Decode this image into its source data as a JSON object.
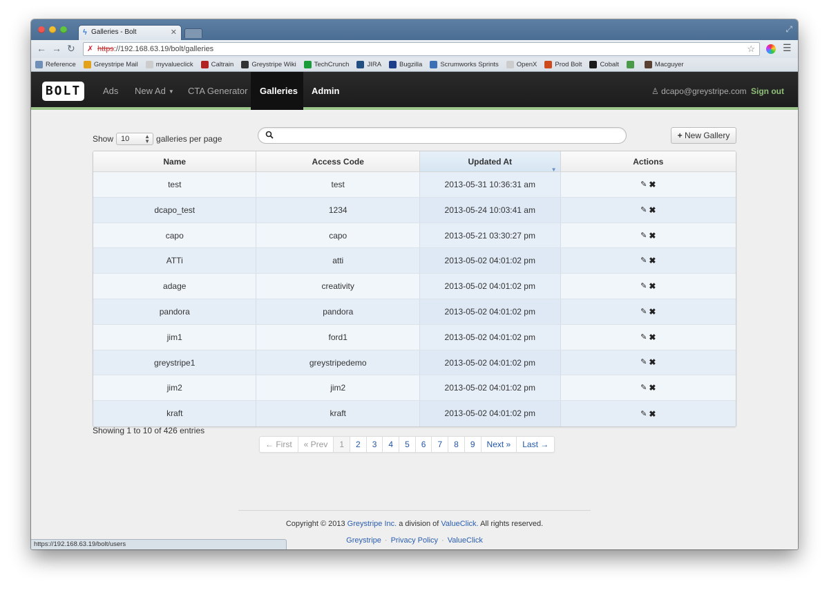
{
  "browser": {
    "tab_title": "Galleries - Bolt",
    "url_protocol": "https",
    "url_rest": "://192.168.63.19/bolt/galleries",
    "status_url": "https://192.168.63.19/bolt/users"
  },
  "bookmarks": [
    {
      "label": "Reference",
      "icon": "folder-icon",
      "color": "#6f8fb6"
    },
    {
      "label": "Greystripe Mail",
      "icon": "mail-icon",
      "color": "#e3a21a"
    },
    {
      "label": "myvalueclick",
      "icon": "page-icon",
      "color": "#cccccc"
    },
    {
      "label": "Caltrain",
      "icon": "caltrain-icon",
      "color": "#b22222"
    },
    {
      "label": "Greystripe Wiki",
      "icon": "wiki-icon",
      "color": "#333333"
    },
    {
      "label": "TechCrunch",
      "icon": "techcrunch-icon",
      "color": "#1a9b3a"
    },
    {
      "label": "JIRA",
      "icon": "jira-icon",
      "color": "#205081"
    },
    {
      "label": "Bugzilla",
      "icon": "bugzilla-icon",
      "color": "#1d3f8a"
    },
    {
      "label": "Scrumworks Sprints",
      "icon": "scrum-icon",
      "color": "#3b70b7"
    },
    {
      "label": "OpenX",
      "icon": "page-icon",
      "color": "#cccccc"
    },
    {
      "label": "Prod Bolt",
      "icon": "bolt-icon",
      "color": "#cc4a1b"
    },
    {
      "label": "Cobalt",
      "icon": "cobalt-icon",
      "color": "#1a1a1a"
    },
    {
      "label": "",
      "icon": "globe-icon",
      "color": "#4a9a4a"
    },
    {
      "label": "Macguyer",
      "icon": "macguyer-icon",
      "color": "#5a4030"
    }
  ],
  "app": {
    "logo": "BOLT",
    "nav": {
      "ads": "Ads",
      "new_ad": "New Ad",
      "cta": "CTA Generator",
      "galleries": "Galleries",
      "admin": "Admin"
    },
    "user_email": "dcapo@greystripe.com",
    "sign_out": "Sign out"
  },
  "controls": {
    "show_label": "Show",
    "per_page_value": "10",
    "per_page_suffix": "galleries per page",
    "search_placeholder": "",
    "new_gallery": "New Gallery"
  },
  "table": {
    "columns": [
      "Name",
      "Access Code",
      "Updated At",
      "Actions"
    ],
    "sorted_column": "Updated At",
    "rows": [
      {
        "name": "test",
        "code": "test",
        "updated": "2013-05-31 10:36:31 am"
      },
      {
        "name": "dcapo_test",
        "code": "1234",
        "updated": "2013-05-24 10:03:41 am"
      },
      {
        "name": "capo",
        "code": "capo",
        "updated": "2013-05-21 03:30:27 pm"
      },
      {
        "name": "ATTi",
        "code": "atti",
        "updated": "2013-05-02 04:01:02 pm"
      },
      {
        "name": "adage",
        "code": "creativity",
        "updated": "2013-05-02 04:01:02 pm"
      },
      {
        "name": "pandora",
        "code": "pandora",
        "updated": "2013-05-02 04:01:02 pm"
      },
      {
        "name": "jim1",
        "code": "ford1",
        "updated": "2013-05-02 04:01:02 pm"
      },
      {
        "name": "greystripe1",
        "code": "greystripedemo",
        "updated": "2013-05-02 04:01:02 pm"
      },
      {
        "name": "jim2",
        "code": "jim2",
        "updated": "2013-05-02 04:01:02 pm"
      },
      {
        "name": "kraft",
        "code": "kraft",
        "updated": "2013-05-02 04:01:02 pm"
      }
    ]
  },
  "info": "Showing 1 to 10 of 426 entries",
  "pagination": {
    "first": "← First",
    "prev": "« Prev",
    "pages": [
      "1",
      "2",
      "3",
      "4",
      "5",
      "6",
      "7",
      "8",
      "9"
    ],
    "current": "1",
    "next": "Next »",
    "last": "Last →"
  },
  "footer": {
    "copyright_prefix": "Copyright © 2013",
    "company": "Greystripe Inc.",
    "middle": "a division of",
    "parent": "ValueClick.",
    "suffix": "All rights reserved.",
    "links": [
      "Greystripe",
      "Privacy Policy",
      "ValueClick"
    ]
  }
}
